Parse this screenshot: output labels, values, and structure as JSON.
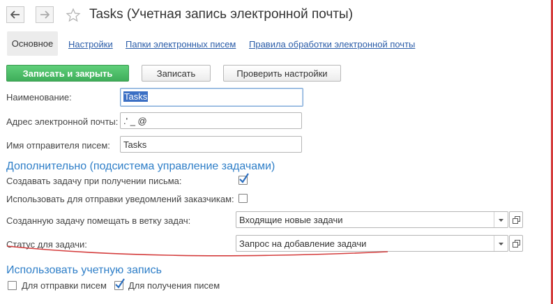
{
  "header": {
    "title": "Tasks (Учетная запись электронной почты)"
  },
  "tabs": [
    {
      "label": "Основное"
    },
    {
      "label": "Настройки"
    },
    {
      "label": "Папки электронных писем"
    },
    {
      "label": "Правила обработки электронной почты"
    }
  ],
  "toolbar": {
    "save_close_label": "Записать и закрыть",
    "save_label": "Записать",
    "check_label": "Проверить настройки"
  },
  "form": {
    "name_label": "Наименование:",
    "name_value": "Tasks",
    "email_label": "Адрес электронной почты:",
    "email_value": ".'  _  @",
    "sender_label": "Имя отправителя писем:",
    "sender_value": "Tasks"
  },
  "additional": {
    "heading": "Дополнительно (подсистема управление задачами)",
    "create_task_label": "Создавать задачу при получении письма:",
    "create_task_checked": true,
    "notify_label": "Использовать для отправки уведомлений заказчикам:",
    "notify_checked": false,
    "branch_label": "Созданную задачу помещать в ветку задач:",
    "branch_value": "Входящие новые задачи",
    "status_label": "Статус для задачи:",
    "status_value": "Запрос на добавление задачи"
  },
  "usage": {
    "heading": "Использовать учетную запись",
    "send_label": "Для отправки писем",
    "send_checked": false,
    "receive_label": "Для получения писем",
    "receive_checked": true
  },
  "colors": {
    "accent": "#2f7fc8",
    "link": "#2a5ca8",
    "primary_button": "#4cbf66",
    "annotation": "#d43c3c"
  }
}
